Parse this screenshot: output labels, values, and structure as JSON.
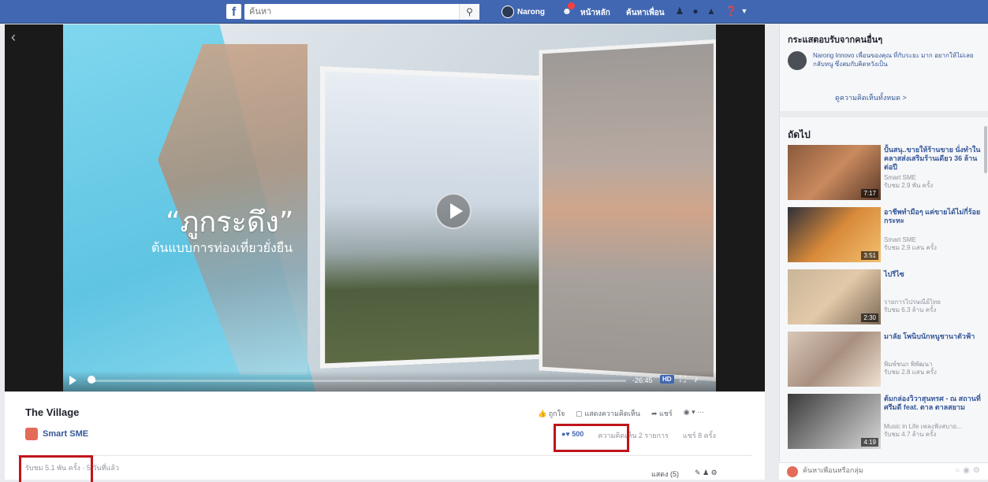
{
  "topbar": {
    "logo": "f",
    "search_placeholder": "ค้นหา",
    "profile_name": "Narong",
    "nav_home": "หน้าหลัก",
    "nav_find_friends": "ค้นหาเพื่อน"
  },
  "video": {
    "overlay_title": "“ภูกระดึง”",
    "overlay_subtitle": "ต้นแบบการท่องเที่ยวยั่งยืน",
    "time": "-26:45",
    "hd": "HD",
    "progress": 0.01
  },
  "info": {
    "title": "The Village",
    "page_name": "Smart SME",
    "actions": {
      "like": "ถูกใจ",
      "comment": "แสดงความคิดเห็น",
      "share": "แชร์"
    },
    "reactions": "500",
    "comments_count": "ความคิดเห็น 2 รายการ",
    "shares": "แชร์ 8 ครั้ง",
    "meta": "รับชม 5.1 พัน ครั้ง · 5 วันที่แล้ว",
    "comment_sort": "แสดง (5)"
  },
  "sidebar": {
    "friends_head": "กระแสตอบรับจากคนอื่นๆ",
    "friend_text": "Narong Innovo เพื่อนของคุณ ที่กับระยะ มาก อยากให้ไม่เลยกลับหนู ซึ่งสมกับคิดหวังเป็น",
    "see_all": "ดูความคิดเห็นทั้งหมด >",
    "next_head": "ถัดไป",
    "videos": [
      {
        "title": "ปั้นสนุ..ขายให้ร้านขาย นั่งทำในคลาสส่งเสริมร้านเดียว 36 ล้านต่อปี",
        "channel": "Smart SME",
        "views": "รับชม 2.9 พัน ครั้ง",
        "duration": "7:17"
      },
      {
        "title": "อาชีพทำมือๆ แค่ขายได้ไม่กี่ร้อยกระทะ",
        "channel": "Smart SME",
        "views": "รับชม 2.9 แสน ครั้ง",
        "duration": "3:51"
      },
      {
        "title": "ไปรีไซ",
        "channel": "รายการไปรษณีย์ไทย",
        "views": "รับชม 6.3 ล้าน ครั้ง",
        "duration": "2:30"
      },
      {
        "title": "มาลัย โพนิบนักหนูชานาตัวฟ้า",
        "channel": "พิมพ์ชนก พิพัฒนา",
        "views": "รับชม 2.8 แสน ครั้ง",
        "duration": ""
      },
      {
        "title": "ต้มกล่องวิวาสุนทรศ - ณ สถานที่ ศรีมดี feat. ตาล ตาลสยาม",
        "channel": "Music in Life เพลงฟังสบาย...",
        "views": "รับชม 4.7 ล้าน ครั้ง",
        "duration": "4:19"
      }
    ],
    "chat_placeholder": "ค้นหาเพื่อนหรือกลุ่ม"
  }
}
